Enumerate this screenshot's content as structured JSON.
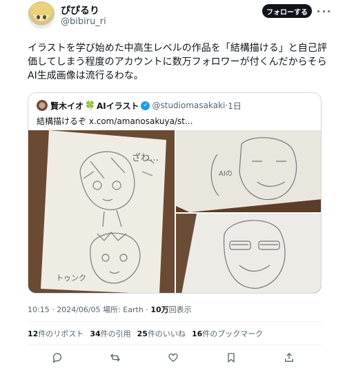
{
  "author": {
    "display_name": "ぴぴるり",
    "handle": "@bibiru_ri",
    "follow_label": "フォローする"
  },
  "tweet": {
    "text": "イラストを学び始めた中高生レベルの作品を「結構描ける」と自己評価してしまう程度のアカウントに数万フォロワーが付くんだからそらAI生成画像は流行るわな。"
  },
  "quote": {
    "name": "賢木イオ",
    "clover": "🍀",
    "name_suffix": "AIイラスト",
    "handle": "@studiomasakaki",
    "separator": "·",
    "time": "1日",
    "text": "結構描けるぞ x.com/amanosakuya/st..."
  },
  "meta": {
    "time": "10:15",
    "dot1": "·",
    "date": "2024/06/05",
    "location": "場所: Earth",
    "dot2": "·",
    "views_count": "10万",
    "views_label": "回表示"
  },
  "stats": [
    {
      "count": "12",
      "label": "件のリポスト"
    },
    {
      "count": "34",
      "label": "件の引用"
    },
    {
      "count": "25",
      "label": "件のいいね"
    },
    {
      "count": "16",
      "label": "件のブックマーク"
    }
  ],
  "icons": {
    "more": "more-icon",
    "verified": "verified-badge-icon",
    "reply": "reply-icon",
    "repost": "repost-icon",
    "like": "like-icon",
    "bookmark": "bookmark-icon",
    "share": "share-icon"
  },
  "colors": {
    "text_primary": "#0f1419",
    "text_secondary": "#536471",
    "accent_blue": "#1d9bf0",
    "follow_button_bg": "#0f1419",
    "border": "#cfd9de"
  }
}
